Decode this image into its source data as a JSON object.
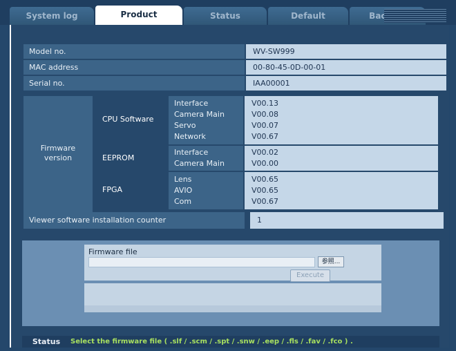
{
  "tabs": [
    {
      "label": "System log",
      "active": false
    },
    {
      "label": "Product info.",
      "active": true
    },
    {
      "label": "Status",
      "active": false
    },
    {
      "label": "Default reset",
      "active": false
    },
    {
      "label": "Back up",
      "active": false
    }
  ],
  "info": {
    "model": {
      "label": "Model no.",
      "value": "WV-SW999"
    },
    "mac": {
      "label": "MAC address",
      "value": "00-80-45-0D-00-01"
    },
    "serial": {
      "label": "Serial no.",
      "value": "IAA00001"
    }
  },
  "firmware": {
    "label_line1": "Firmware",
    "label_line2": "version",
    "groups": [
      {
        "name": "CPU Software",
        "items": [
          {
            "label": "Interface",
            "value": "V00.13"
          },
          {
            "label": "Camera Main",
            "value": "V00.08"
          },
          {
            "label": "Servo",
            "value": "V00.07"
          },
          {
            "label": "Network",
            "value": "V00.67"
          }
        ]
      },
      {
        "name": "EEPROM",
        "items": [
          {
            "label": "Interface",
            "value": "V00.02"
          },
          {
            "label": "Camera Main",
            "value": "V00.00"
          }
        ]
      },
      {
        "name": "FPGA",
        "items": [
          {
            "label": "Lens",
            "value": "V00.65"
          },
          {
            "label": "AVIO",
            "value": "V00.65"
          },
          {
            "label": "Com",
            "value": "V00.67"
          }
        ]
      }
    ]
  },
  "counter": {
    "label": "Viewer software installation counter",
    "value": "1"
  },
  "update": {
    "file_label": "Firmware file",
    "file_value": "",
    "browse_label": "参照...",
    "execute_label": "Execute"
  },
  "status": {
    "label": "Status",
    "message": "Select the firmware file ( .slf / .scm / .spt / .snw / .eep / .fls / .fav / .fco ) ."
  },
  "colors": {
    "accent_green": "#a8e05f",
    "background": "#24476b",
    "value_cell": "#c5d7e8"
  }
}
